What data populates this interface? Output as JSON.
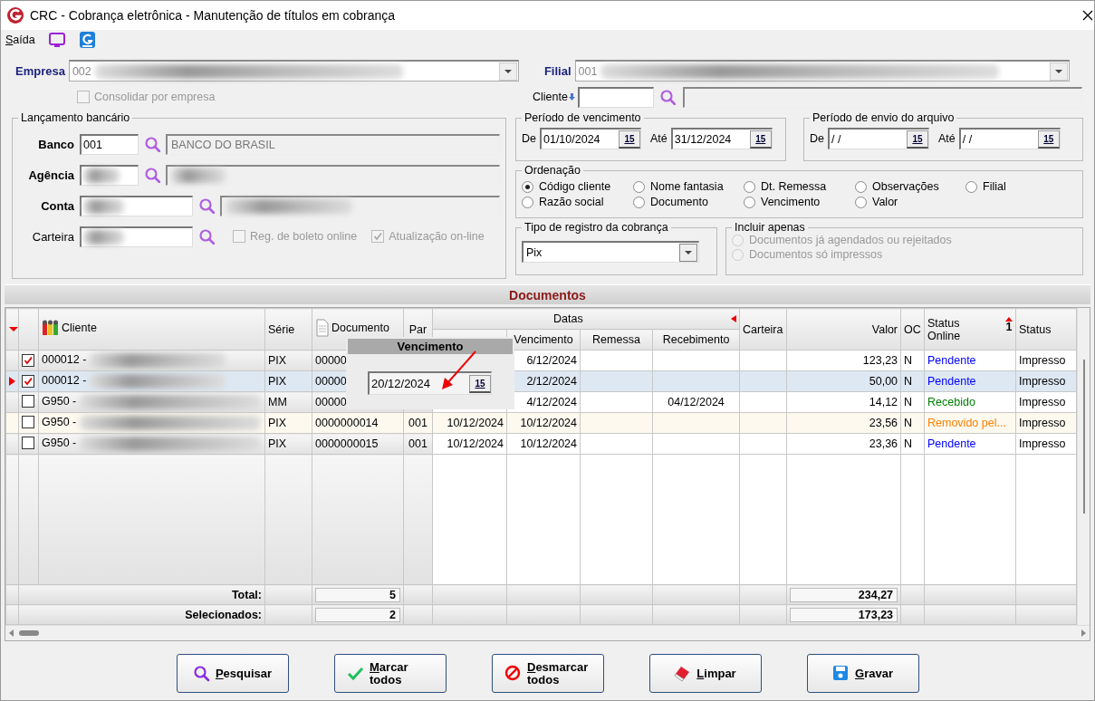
{
  "window": {
    "title": "CRC - Cobrança eletrônica - Manutenção de títulos em cobrança"
  },
  "menu": {
    "label": "Saída"
  },
  "empresa": {
    "label": "Empresa",
    "value": "002",
    "blurred": true
  },
  "filial": {
    "label": "Filial",
    "value": "001",
    "blurred": true
  },
  "consolidar": {
    "label": "Consolidar por empresa",
    "checked": false,
    "disabled": true
  },
  "cliente": {
    "label": "Cliente"
  },
  "lancamento": {
    "title": "Lançamento bancário",
    "fields": [
      {
        "kind": "short",
        "label": "Banco",
        "required": true,
        "code": "001",
        "name": "BANCO DO BRASIL"
      },
      {
        "kind": "short",
        "label": "Agência",
        "required": true,
        "blurred": true
      },
      {
        "kind": "long",
        "label": "Conta",
        "required": true,
        "blurred": true
      },
      {
        "kind": "options",
        "label": "Carteira",
        "required": false,
        "blurred": true,
        "options": [
          {
            "label": "Reg. de boleto online",
            "checked": false,
            "disabled": true
          },
          {
            "label": "Atualização on-line",
            "checked": true,
            "disabled": true
          }
        ]
      }
    ]
  },
  "periodo_vencimento": {
    "title": "Período de vencimento",
    "fields": [
      {
        "label": "De",
        "value": "01/10/2024",
        "picker": "15"
      },
      {
        "label": "Até",
        "value": "31/12/2024",
        "picker": "15"
      }
    ]
  },
  "periodo_envio": {
    "title": "Período de envio do arquivo",
    "fields": [
      {
        "label": "De",
        "value": "/ /",
        "picker": "15"
      },
      {
        "label": "Até",
        "value": "/ /",
        "picker": "15"
      }
    ]
  },
  "ordenacao": {
    "title": "Ordenação",
    "options": [
      {
        "label": "Código cliente",
        "selected": true
      },
      {
        "label": "Nome fantasia",
        "selected": false
      },
      {
        "label": "Dt. Remessa",
        "selected": false
      },
      {
        "label": "Observações",
        "selected": false
      },
      {
        "label": "Filial",
        "selected": false
      },
      {
        "label": "Razão social",
        "selected": false
      },
      {
        "label": "Documento",
        "selected": false
      },
      {
        "label": "Vencimento",
        "selected": false
      },
      {
        "label": "Valor",
        "selected": false
      }
    ]
  },
  "tipo_registro": {
    "title": "Tipo de registro da cobrança",
    "value": "Pix"
  },
  "incluir": {
    "title": "Incluir apenas",
    "options": [
      {
        "label": "Documentos já agendados ou rejeitados",
        "selected": false,
        "disabled": true
      },
      {
        "label": "Documentos só impressos",
        "selected": false,
        "disabled": true
      }
    ]
  },
  "section_title": "Documentos",
  "table": {
    "columns": [
      {
        "label": "Cliente"
      },
      {
        "label": "Série"
      },
      {
        "label": "Documento"
      },
      {
        "label": "Par"
      }
    ],
    "group": {
      "label": "Datas",
      "columns": [
        {
          "label": "Vencimento"
        },
        {
          "label": "Remessa"
        },
        {
          "label": "Recebimento"
        }
      ]
    },
    "columns_after": [
      {
        "label": "Carteira"
      },
      {
        "label": "Valor"
      },
      {
        "label": "OC"
      },
      {
        "label": "Status Online",
        "sort": "1"
      },
      {
        "label": "Status"
      }
    ],
    "rows": [
      {
        "current": false,
        "checked": true,
        "kind": "normal",
        "cliente": "000012 -",
        "blurred": true,
        "serie": "PIX",
        "documento": "00000",
        "vencimento": "6/12/2024",
        "valor": "123,23",
        "oc": "N",
        "status_online": {
          "text": "Pendente",
          "color": "#0000ff"
        },
        "status": "Impresso"
      },
      {
        "current": true,
        "checked": true,
        "kind": "normal",
        "cliente": "000012 -",
        "blurred": true,
        "serie": "PIX",
        "documento": "00000",
        "vencimento": "2/12/2024",
        "valor": "50,00",
        "oc": "N",
        "status_online": {
          "text": "Pendente",
          "color": "#0000ff"
        },
        "status": "Impresso"
      },
      {
        "current": false,
        "checked": false,
        "kind": "normal",
        "cliente": "G950 -",
        "blurred": true,
        "serie": "MM",
        "documento": "00000",
        "vencimento": "4/12/2024",
        "recebimento": "04/12/2024",
        "valor": "14,12",
        "oc": "N",
        "status_online": {
          "text": "Recebido",
          "color": "#008000"
        },
        "status": "Impresso"
      },
      {
        "current": false,
        "checked": false,
        "kind": "removed",
        "cliente": "G950 -",
        "blurred": true,
        "serie": "PIX",
        "documento": "0000000014",
        "par": "001",
        "emissao": "10/12/2024",
        "vencimento": "10/12/2024",
        "valor": "23,56",
        "oc": "N",
        "status_online": {
          "text": "Removido pel...",
          "color": "#ff8000"
        },
        "status": "Impresso"
      },
      {
        "current": false,
        "checked": false,
        "kind": "normal",
        "cliente": "G950 -",
        "blurred": true,
        "serie": "PIX",
        "documento": "0000000015",
        "par": "001",
        "emissao": "10/12/2024",
        "vencimento": "10/12/2024",
        "valor": "23,36",
        "oc": "N",
        "status_online": {
          "text": "Pendente",
          "color": "#0000ff"
        },
        "status": "Impresso"
      }
    ],
    "totals": [
      {
        "label": "Total:",
        "count": "5",
        "value": "234,27"
      },
      {
        "label": "Selecionados:",
        "count": "2",
        "value": "173,23"
      }
    ]
  },
  "popup": {
    "title": "Vencimento",
    "value": "20/12/2024",
    "picker": "15"
  },
  "buttons": [
    {
      "label": "Pesquisar"
    },
    {
      "label": "Marcar todos"
    },
    {
      "label": "Desmarcar todos"
    },
    {
      "label": "Limpar"
    },
    {
      "label": "Gravar"
    }
  ]
}
